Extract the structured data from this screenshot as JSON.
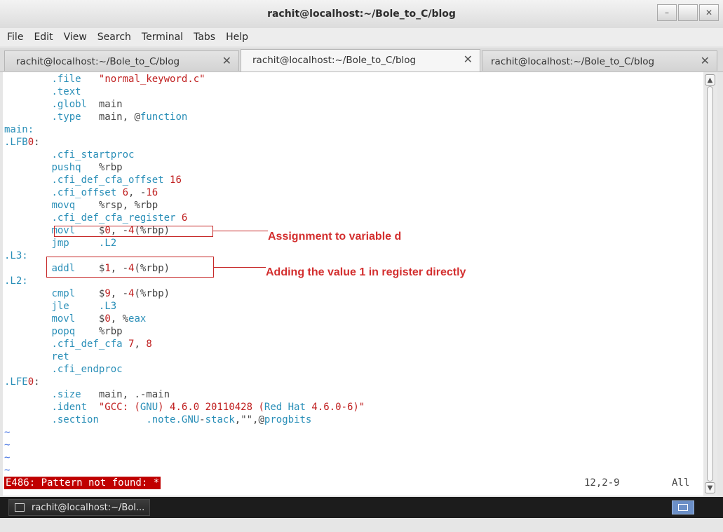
{
  "window": {
    "title": "rachit@localhost:~/Bole_to_C/blog"
  },
  "menu": [
    "File",
    "Edit",
    "View",
    "Search",
    "Terminal",
    "Tabs",
    "Help"
  ],
  "tabs": [
    {
      "label": "rachit@localhost:~/Bole_to_C/blog",
      "close": "✕",
      "active": false
    },
    {
      "label": "rachit@localhost:~/Bole_to_C/blog",
      "close": "✕",
      "active": true
    },
    {
      "label": "rachit@localhost:~/Bole_to_C/blog",
      "close": "✕",
      "active": false
    }
  ],
  "terminal": {
    "lines": [
      [
        [
          "        ",
          "p"
        ],
        [
          ".file",
          "d"
        ],
        [
          "   ",
          "p"
        ],
        [
          "\"normal_keyword.c\"",
          "s"
        ]
      ],
      [
        [
          "        ",
          "p"
        ],
        [
          ".text",
          "d"
        ]
      ],
      [
        [
          "        ",
          "p"
        ],
        [
          ".globl",
          "d"
        ],
        [
          "  main",
          "p"
        ]
      ],
      [
        [
          "        ",
          "p"
        ],
        [
          ".type",
          "d"
        ],
        [
          "   main, @",
          "p"
        ],
        [
          "function",
          "d"
        ]
      ],
      [
        [
          "main:",
          "l"
        ]
      ],
      [
        [
          ".LFB",
          "l"
        ],
        [
          "0",
          "n"
        ],
        [
          ":",
          "p"
        ]
      ],
      [
        [
          "        ",
          "p"
        ],
        [
          ".cfi_startproc",
          "d"
        ]
      ],
      [
        [
          "        ",
          "p"
        ],
        [
          "pushq",
          "i"
        ],
        [
          "   %rbp",
          "p"
        ]
      ],
      [
        [
          "        ",
          "p"
        ],
        [
          ".cfi_def_cfa_offset",
          "d"
        ],
        [
          " ",
          "p"
        ],
        [
          "16",
          "n"
        ]
      ],
      [
        [
          "        ",
          "p"
        ],
        [
          ".cfi_offset",
          "d"
        ],
        [
          " ",
          "p"
        ],
        [
          "6",
          "n"
        ],
        [
          ", -",
          "p"
        ],
        [
          "16",
          "n"
        ]
      ],
      [
        [
          "        ",
          "p"
        ],
        [
          "movq",
          "i"
        ],
        [
          "    %rsp, %rbp",
          "p"
        ]
      ],
      [
        [
          "        ",
          "p"
        ],
        [
          ".cfi_def_cfa_register",
          "d"
        ],
        [
          " ",
          "p"
        ],
        [
          "6",
          "n"
        ]
      ],
      [
        [
          "        ",
          "p"
        ],
        [
          "movl",
          "i"
        ],
        [
          "    $",
          "p"
        ],
        [
          "0",
          "n"
        ],
        [
          ", -",
          "p"
        ],
        [
          "4",
          "n"
        ],
        [
          "(%rbp)",
          "p"
        ]
      ],
      [
        [
          "        ",
          "p"
        ],
        [
          "jmp",
          "i"
        ],
        [
          "     ",
          "p"
        ],
        [
          ".L2",
          "d"
        ]
      ],
      [
        [
          ".L3:",
          "l"
        ]
      ],
      [
        [
          "        ",
          "p"
        ],
        [
          "addl",
          "i"
        ],
        [
          "    $",
          "p"
        ],
        [
          "1",
          "n"
        ],
        [
          ", -",
          "p"
        ],
        [
          "4",
          "n"
        ],
        [
          "(%rbp)",
          "p"
        ]
      ],
      [
        [
          ".L2:",
          "l"
        ]
      ],
      [
        [
          "        ",
          "p"
        ],
        [
          "cmpl",
          "i"
        ],
        [
          "    $",
          "p"
        ],
        [
          "9",
          "n"
        ],
        [
          ", -",
          "p"
        ],
        [
          "4",
          "n"
        ],
        [
          "(%rbp)",
          "p"
        ]
      ],
      [
        [
          "        ",
          "p"
        ],
        [
          "jle",
          "i"
        ],
        [
          "     ",
          "p"
        ],
        [
          ".L3",
          "d"
        ]
      ],
      [
        [
          "        ",
          "p"
        ],
        [
          "movl",
          "i"
        ],
        [
          "    $",
          "p"
        ],
        [
          "0",
          "n"
        ],
        [
          ", %",
          "p"
        ],
        [
          "eax",
          "d"
        ]
      ],
      [
        [
          "        ",
          "p"
        ],
        [
          "popq",
          "i"
        ],
        [
          "    %rbp",
          "p"
        ]
      ],
      [
        [
          "        ",
          "p"
        ],
        [
          ".cfi_def_cfa",
          "d"
        ],
        [
          " ",
          "p"
        ],
        [
          "7",
          "n"
        ],
        [
          ", ",
          "p"
        ],
        [
          "8",
          "n"
        ]
      ],
      [
        [
          "        ",
          "p"
        ],
        [
          "ret",
          "i"
        ]
      ],
      [
        [
          "        ",
          "p"
        ],
        [
          ".cfi_endproc",
          "d"
        ]
      ],
      [
        [
          ".LFE",
          "l"
        ],
        [
          "0",
          "n"
        ],
        [
          ":",
          "p"
        ]
      ],
      [
        [
          "        ",
          "p"
        ],
        [
          ".size",
          "d"
        ],
        [
          "   main, .-main",
          "p"
        ]
      ],
      [
        [
          "        ",
          "p"
        ],
        [
          ".ident",
          "d"
        ],
        [
          "  \"GCC: (",
          "s"
        ],
        [
          "GNU",
          "d"
        ],
        [
          ") ",
          "s"
        ],
        [
          "4.6.0 20110428",
          "n"
        ],
        [
          " (",
          "s"
        ],
        [
          "Red Hat",
          "d"
        ],
        [
          " ",
          "s"
        ],
        [
          "4.6.0",
          "n"
        ],
        [
          "-6)\"",
          "s"
        ]
      ],
      [
        [
          "        ",
          "p"
        ],
        [
          ".section",
          "d"
        ],
        [
          "        ",
          "p"
        ],
        [
          ".note.GNU",
          "d"
        ],
        [
          "-",
          "p"
        ],
        [
          "stack",
          "d"
        ],
        [
          ",\"\",@",
          "p"
        ],
        [
          "progbits",
          "d"
        ]
      ],
      [
        [
          "~",
          "t"
        ]
      ],
      [
        [
          "~",
          "t"
        ]
      ],
      [
        [
          "~",
          "t"
        ]
      ],
      [
        [
          "~",
          "t"
        ]
      ]
    ],
    "status_message": "E486: Pattern not found: *",
    "cursor_position": "12,2-9",
    "file_position": "All"
  },
  "annotations": [
    {
      "text": "Assignment to variable d"
    },
    {
      "text": "Adding the value 1 in register directly"
    }
  ],
  "colors": {
    "directive": "#2a8fb8",
    "number": "#c02020",
    "error_bg": "#c00000",
    "annotation": "#d32f2f"
  },
  "taskbar": {
    "item_label": "rachit@localhost:~/Bol..."
  }
}
